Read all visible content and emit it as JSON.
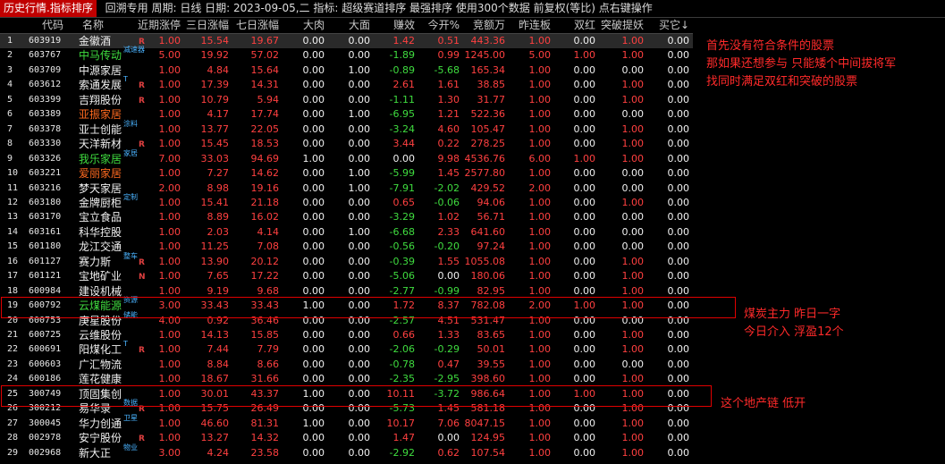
{
  "topbar": {
    "tab": "历史行情.指标排序",
    "text": "回溯专用 周期: 日线 日期: 2023-09-05,二 指标: 超级赛道排序 最强排序  使用300个数据 前复权(等比) 点右键操作"
  },
  "columns": [
    "",
    "代码",
    "名称",
    "近期涨停",
    "三日涨幅",
    "七日涨幅",
    "大肉",
    "大面",
    "赚效",
    "今开%",
    "竞额万",
    "昨连板",
    "双红",
    "突破提妖",
    "买它↓"
  ],
  "rows": [
    {
      "i": "1",
      "code": "603919",
      "name": "金徽酒",
      "name_color": "white",
      "tag": "",
      "flag": "R",
      "v": [
        "1.00",
        "15.54",
        "19.67",
        "0.00",
        "0.00",
        "1.42",
        "0.51",
        "443.36",
        "1.00",
        "0.00",
        "1.00",
        "0.00"
      ],
      "c": [
        "red",
        "red",
        "red",
        "white",
        "white",
        "red",
        "red",
        "red",
        "red",
        "white",
        "red",
        "white"
      ]
    },
    {
      "i": "2",
      "code": "603767",
      "name": "中马传动",
      "name_color": "green",
      "tag": "减速器",
      "flag": "",
      "v": [
        "5.00",
        "19.92",
        "57.02",
        "0.00",
        "0.00",
        "-1.89",
        "0.99",
        "1245.00",
        "5.00",
        "1.00",
        "1.00",
        "0.00"
      ],
      "c": [
        "red",
        "red",
        "red",
        "white",
        "white",
        "green",
        "red",
        "red",
        "red",
        "red",
        "red",
        "white"
      ]
    },
    {
      "i": "3",
      "code": "603709",
      "name": "中源家居",
      "name_color": "white",
      "tag": "",
      "flag": "",
      "v": [
        "1.00",
        "4.84",
        "15.64",
        "0.00",
        "1.00",
        "-0.89",
        "-5.68",
        "165.34",
        "1.00",
        "0.00",
        "0.00",
        "0.00"
      ],
      "c": [
        "red",
        "red",
        "red",
        "white",
        "white",
        "green",
        "green",
        "red",
        "red",
        "white",
        "white",
        "white"
      ]
    },
    {
      "i": "4",
      "code": "603612",
      "name": "索通发展",
      "name_color": "white",
      "tag": "T",
      "flag": "R",
      "v": [
        "1.00",
        "17.39",
        "14.31",
        "0.00",
        "0.00",
        "2.61",
        "1.61",
        "38.85",
        "1.00",
        "0.00",
        "1.00",
        "0.00"
      ],
      "c": [
        "red",
        "red",
        "red",
        "white",
        "white",
        "red",
        "red",
        "red",
        "red",
        "white",
        "red",
        "white"
      ]
    },
    {
      "i": "5",
      "code": "603399",
      "name": "吉翔股份",
      "name_color": "white",
      "tag": "",
      "flag": "R",
      "v": [
        "1.00",
        "10.79",
        "5.94",
        "0.00",
        "0.00",
        "-1.11",
        "1.30",
        "31.77",
        "1.00",
        "0.00",
        "1.00",
        "0.00"
      ],
      "c": [
        "red",
        "red",
        "red",
        "white",
        "white",
        "green",
        "red",
        "red",
        "red",
        "white",
        "red",
        "white"
      ]
    },
    {
      "i": "6",
      "code": "603389",
      "name": "亚振家居",
      "name_color": "orange",
      "tag": "",
      "flag": "",
      "v": [
        "1.00",
        "4.17",
        "17.74",
        "0.00",
        "1.00",
        "-6.95",
        "1.21",
        "522.36",
        "1.00",
        "0.00",
        "0.00",
        "0.00"
      ],
      "c": [
        "red",
        "red",
        "red",
        "white",
        "white",
        "green",
        "red",
        "red",
        "red",
        "white",
        "white",
        "white"
      ]
    },
    {
      "i": "7",
      "code": "603378",
      "name": "亚士创能",
      "name_color": "white",
      "tag": "涂料",
      "flag": "",
      "v": [
        "1.00",
        "13.77",
        "22.05",
        "0.00",
        "0.00",
        "-3.24",
        "4.60",
        "105.47",
        "1.00",
        "0.00",
        "1.00",
        "0.00"
      ],
      "c": [
        "red",
        "red",
        "red",
        "white",
        "white",
        "green",
        "red",
        "red",
        "red",
        "white",
        "red",
        "white"
      ]
    },
    {
      "i": "8",
      "code": "603330",
      "name": "天洋新材",
      "name_color": "white",
      "tag": "",
      "flag": "R",
      "v": [
        "1.00",
        "15.45",
        "18.53",
        "0.00",
        "0.00",
        "3.44",
        "0.22",
        "278.25",
        "1.00",
        "0.00",
        "1.00",
        "0.00"
      ],
      "c": [
        "red",
        "red",
        "red",
        "white",
        "white",
        "red",
        "red",
        "red",
        "red",
        "white",
        "red",
        "white"
      ]
    },
    {
      "i": "9",
      "code": "603326",
      "name": "我乐家居",
      "name_color": "green",
      "tag": "家居",
      "flag": "",
      "v": [
        "7.00",
        "33.03",
        "94.69",
        "1.00",
        "0.00",
        "0.00",
        "9.98",
        "4536.76",
        "6.00",
        "1.00",
        "1.00",
        "0.00"
      ],
      "c": [
        "red",
        "red",
        "red",
        "white",
        "white",
        "white",
        "red",
        "red",
        "red",
        "red",
        "red",
        "white"
      ]
    },
    {
      "i": "10",
      "code": "603221",
      "name": "爱丽家居",
      "name_color": "orange",
      "tag": "",
      "flag": "",
      "v": [
        "1.00",
        "7.27",
        "14.62",
        "0.00",
        "1.00",
        "-5.99",
        "1.45",
        "2577.80",
        "1.00",
        "0.00",
        "0.00",
        "0.00"
      ],
      "c": [
        "red",
        "red",
        "red",
        "white",
        "white",
        "green",
        "red",
        "red",
        "red",
        "white",
        "white",
        "white"
      ]
    },
    {
      "i": "11",
      "code": "603216",
      "name": "梦天家居",
      "name_color": "white",
      "tag": "",
      "flag": "",
      "v": [
        "2.00",
        "8.98",
        "19.16",
        "0.00",
        "1.00",
        "-7.91",
        "-2.02",
        "429.52",
        "2.00",
        "0.00",
        "0.00",
        "0.00"
      ],
      "c": [
        "red",
        "red",
        "red",
        "white",
        "white",
        "green",
        "green",
        "red",
        "red",
        "white",
        "white",
        "white"
      ]
    },
    {
      "i": "12",
      "code": "603180",
      "name": "金牌厨柜",
      "name_color": "white",
      "tag": "定制",
      "flag": "",
      "v": [
        "1.00",
        "15.41",
        "21.18",
        "0.00",
        "0.00",
        "0.65",
        "-0.06",
        "94.06",
        "1.00",
        "0.00",
        "1.00",
        "0.00"
      ],
      "c": [
        "red",
        "red",
        "red",
        "white",
        "white",
        "red",
        "green",
        "red",
        "red",
        "white",
        "red",
        "white"
      ]
    },
    {
      "i": "13",
      "code": "603170",
      "name": "宝立食品",
      "name_color": "white",
      "tag": "",
      "flag": "",
      "v": [
        "1.00",
        "8.89",
        "16.02",
        "0.00",
        "0.00",
        "-3.29",
        "1.02",
        "56.71",
        "1.00",
        "0.00",
        "0.00",
        "0.00"
      ],
      "c": [
        "red",
        "red",
        "red",
        "white",
        "white",
        "green",
        "red",
        "red",
        "red",
        "white",
        "white",
        "white"
      ]
    },
    {
      "i": "14",
      "code": "603161",
      "name": "科华控股",
      "name_color": "white",
      "tag": "",
      "flag": "",
      "v": [
        "1.00",
        "2.03",
        "4.14",
        "0.00",
        "1.00",
        "-6.68",
        "2.33",
        "641.60",
        "1.00",
        "0.00",
        "0.00",
        "0.00"
      ],
      "c": [
        "red",
        "red",
        "red",
        "white",
        "white",
        "green",
        "red",
        "red",
        "red",
        "white",
        "white",
        "white"
      ]
    },
    {
      "i": "15",
      "code": "601180",
      "name": "龙江交通",
      "name_color": "white",
      "tag": "",
      "flag": "",
      "v": [
        "1.00",
        "11.25",
        "7.08",
        "0.00",
        "0.00",
        "-0.56",
        "-0.20",
        "97.24",
        "1.00",
        "0.00",
        "0.00",
        "0.00"
      ],
      "c": [
        "red",
        "red",
        "red",
        "white",
        "white",
        "green",
        "green",
        "red",
        "red",
        "white",
        "white",
        "white"
      ]
    },
    {
      "i": "16",
      "code": "601127",
      "name": "赛力斯",
      "name_color": "white",
      "tag": "整车",
      "flag": "R",
      "v": [
        "1.00",
        "13.90",
        "20.12",
        "0.00",
        "0.00",
        "-0.39",
        "1.55",
        "1055.08",
        "1.00",
        "0.00",
        "1.00",
        "0.00"
      ],
      "c": [
        "red",
        "red",
        "red",
        "white",
        "white",
        "green",
        "red",
        "red",
        "red",
        "white",
        "red",
        "white"
      ]
    },
    {
      "i": "17",
      "code": "601121",
      "name": "宝地矿业",
      "name_color": "white",
      "tag": "",
      "flag": "N",
      "v": [
        "1.00",
        "7.65",
        "17.22",
        "0.00",
        "0.00",
        "-5.06",
        "0.00",
        "180.06",
        "1.00",
        "0.00",
        "1.00",
        "0.00"
      ],
      "c": [
        "red",
        "red",
        "red",
        "white",
        "white",
        "green",
        "white",
        "red",
        "red",
        "white",
        "red",
        "white"
      ]
    },
    {
      "i": "18",
      "code": "600984",
      "name": "建设机械",
      "name_color": "white",
      "tag": "",
      "flag": "",
      "v": [
        "1.00",
        "9.19",
        "9.68",
        "0.00",
        "0.00",
        "-2.77",
        "-0.99",
        "82.95",
        "1.00",
        "0.00",
        "1.00",
        "0.00"
      ],
      "c": [
        "red",
        "red",
        "red",
        "white",
        "white",
        "green",
        "green",
        "red",
        "red",
        "white",
        "red",
        "white"
      ]
    },
    {
      "i": "19",
      "code": "600792",
      "name": "云煤能源",
      "name_color": "green",
      "tag": "资源",
      "flag": "",
      "v": [
        "3.00",
        "33.43",
        "33.43",
        "1.00",
        "0.00",
        "1.72",
        "8.37",
        "782.08",
        "2.00",
        "1.00",
        "1.00",
        "0.00"
      ],
      "c": [
        "red",
        "red",
        "red",
        "white",
        "white",
        "red",
        "red",
        "red",
        "red",
        "red",
        "red",
        "white"
      ]
    },
    {
      "i": "20",
      "code": "600753",
      "name": "庚星股份",
      "name_color": "white",
      "tag": "储能",
      "flag": "",
      "v": [
        "4.00",
        "0.92",
        "36.46",
        "0.00",
        "0.00",
        "-2.57",
        "4.51",
        "531.47",
        "1.00",
        "0.00",
        "0.00",
        "0.00"
      ],
      "c": [
        "red",
        "red",
        "red",
        "white",
        "white",
        "green",
        "red",
        "red",
        "red",
        "white",
        "white",
        "white"
      ]
    },
    {
      "i": "21",
      "code": "600725",
      "name": "云维股份",
      "name_color": "white",
      "tag": "",
      "flag": "",
      "v": [
        "1.00",
        "14.13",
        "15.85",
        "0.00",
        "0.00",
        "0.66",
        "1.33",
        "83.65",
        "1.00",
        "0.00",
        "1.00",
        "0.00"
      ],
      "c": [
        "red",
        "red",
        "red",
        "white",
        "white",
        "red",
        "red",
        "red",
        "red",
        "white",
        "red",
        "white"
      ]
    },
    {
      "i": "22",
      "code": "600691",
      "name": "阳煤化工",
      "name_color": "white",
      "tag": "T",
      "flag": "R",
      "v": [
        "1.00",
        "7.44",
        "7.79",
        "0.00",
        "0.00",
        "-2.06",
        "-0.29",
        "50.01",
        "1.00",
        "0.00",
        "1.00",
        "0.00"
      ],
      "c": [
        "red",
        "red",
        "red",
        "white",
        "white",
        "green",
        "green",
        "red",
        "red",
        "white",
        "red",
        "white"
      ]
    },
    {
      "i": "23",
      "code": "600603",
      "name": "广汇物流",
      "name_color": "white",
      "tag": "",
      "flag": "",
      "v": [
        "1.00",
        "8.84",
        "8.66",
        "0.00",
        "0.00",
        "-0.78",
        "0.47",
        "39.55",
        "1.00",
        "0.00",
        "0.00",
        "0.00"
      ],
      "c": [
        "red",
        "red",
        "red",
        "white",
        "white",
        "green",
        "red",
        "red",
        "red",
        "white",
        "white",
        "white"
      ]
    },
    {
      "i": "24",
      "code": "600186",
      "name": "莲花健康",
      "name_color": "white",
      "tag": "",
      "flag": "",
      "v": [
        "1.00",
        "18.67",
        "31.66",
        "0.00",
        "0.00",
        "-2.35",
        "-2.95",
        "398.60",
        "1.00",
        "0.00",
        "1.00",
        "0.00"
      ],
      "c": [
        "red",
        "red",
        "red",
        "white",
        "white",
        "green",
        "green",
        "red",
        "red",
        "white",
        "red",
        "white"
      ]
    },
    {
      "i": "25",
      "code": "300749",
      "name": "顶固集创",
      "name_color": "white",
      "tag": "",
      "flag": "",
      "v": [
        "1.00",
        "30.01",
        "43.37",
        "1.00",
        "0.00",
        "10.11",
        "-3.72",
        "986.64",
        "1.00",
        "1.00",
        "1.00",
        "0.00"
      ],
      "c": [
        "red",
        "red",
        "red",
        "white",
        "white",
        "red",
        "green",
        "red",
        "red",
        "red",
        "red",
        "white"
      ]
    },
    {
      "i": "26",
      "code": "300212",
      "name": "易华录",
      "name_color": "white",
      "tag": "数据",
      "flag": "R",
      "v": [
        "1.00",
        "15.75",
        "26.49",
        "0.00",
        "0.00",
        "-5.73",
        "1.45",
        "581.18",
        "1.00",
        "0.00",
        "1.00",
        "0.00"
      ],
      "c": [
        "red",
        "red",
        "red",
        "white",
        "white",
        "green",
        "red",
        "red",
        "red",
        "white",
        "red",
        "white"
      ]
    },
    {
      "i": "27",
      "code": "300045",
      "name": "华力创通",
      "name_color": "white",
      "tag": "卫星",
      "flag": "",
      "v": [
        "1.00",
        "46.60",
        "81.31",
        "1.00",
        "0.00",
        "10.17",
        "7.06",
        "8047.15",
        "1.00",
        "0.00",
        "1.00",
        "0.00"
      ],
      "c": [
        "red",
        "red",
        "red",
        "white",
        "white",
        "red",
        "red",
        "red",
        "red",
        "white",
        "red",
        "white"
      ]
    },
    {
      "i": "28",
      "code": "002978",
      "name": "安宁股份",
      "name_color": "white",
      "tag": "",
      "flag": "R",
      "v": [
        "1.00",
        "13.27",
        "14.32",
        "0.00",
        "0.00",
        "1.47",
        "0.00",
        "124.95",
        "1.00",
        "0.00",
        "1.00",
        "0.00"
      ],
      "c": [
        "red",
        "red",
        "red",
        "white",
        "white",
        "red",
        "white",
        "red",
        "red",
        "white",
        "red",
        "white"
      ]
    },
    {
      "i": "29",
      "code": "002968",
      "name": "新大正",
      "name_color": "white",
      "tag": "物业",
      "flag": "",
      "v": [
        "3.00",
        "4.24",
        "23.58",
        "0.00",
        "0.00",
        "-2.92",
        "0.62",
        "107.54",
        "1.00",
        "0.00",
        "1.00",
        "0.00"
      ],
      "c": [
        "red",
        "red",
        "red",
        "white",
        "white",
        "green",
        "red",
        "red",
        "red",
        "white",
        "red",
        "white"
      ]
    }
  ],
  "annotations": {
    "top_lines": [
      "首先没有符合条件的股票",
      "那如果还想参与 只能矮个中间拔将军",
      "找同时满足双红和突破的股票"
    ],
    "mid_lines": [
      "煤炭主力 昨日一字",
      "今日介入 浮盈12个"
    ],
    "bottom_lines": [
      "这个地产链 低开"
    ]
  },
  "colors": {
    "red": "#ff4040",
    "green": "#3fdc3f",
    "white": "#f0f0f0",
    "yellow": "#ffd400",
    "orange": "#ff6a1f",
    "accent": "#c00000",
    "tag": "#4ab3ff"
  }
}
